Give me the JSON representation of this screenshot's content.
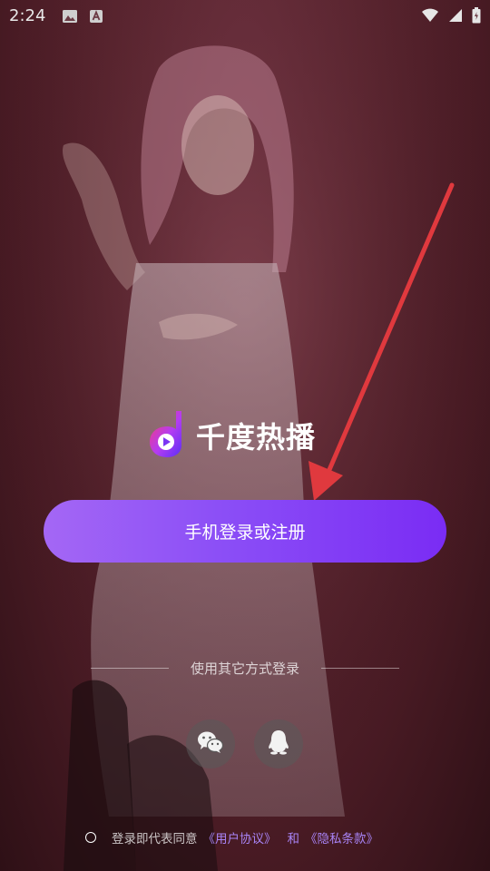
{
  "status_bar": {
    "time": "2:24",
    "left_icons": [
      "image-icon",
      "app-a-icon"
    ],
    "right_icons": [
      "wifi-icon",
      "signal-icon",
      "battery-icon"
    ]
  },
  "logo": {
    "title": "千度热播",
    "icon": "qiandu-logo-icon"
  },
  "login": {
    "phone_button_label": "手机登录或注册"
  },
  "other_methods": {
    "label": "使用其它方式登录",
    "items": [
      {
        "name": "wechat",
        "icon": "wechat-icon"
      },
      {
        "name": "qq",
        "icon": "qq-icon"
      }
    ]
  },
  "agreement": {
    "prefix": "登录即代表同意",
    "user_agreement": "《用户协议》",
    "and": "和",
    "privacy_policy": "《隐私条款》"
  },
  "colors": {
    "accent_start": "#a467f5",
    "accent_end": "#7a2cf4",
    "link": "#a883f5",
    "arrow": "#e0393e"
  }
}
